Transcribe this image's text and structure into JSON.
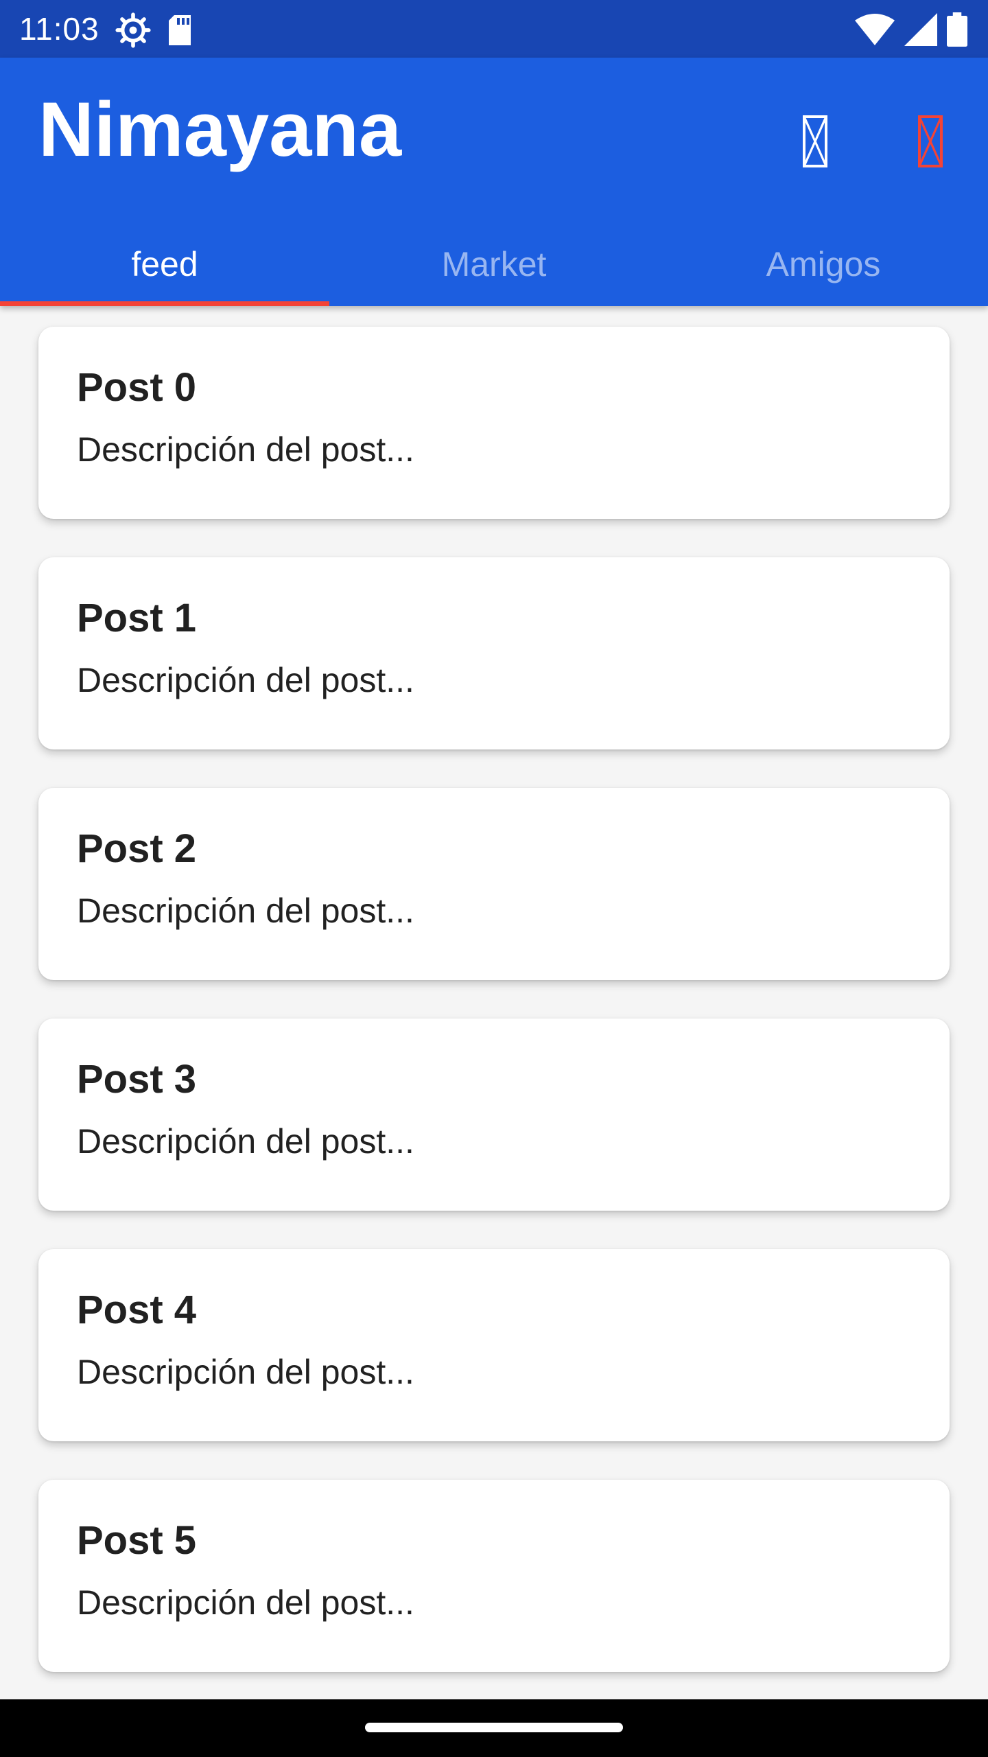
{
  "status_bar": {
    "time": "11:03",
    "icons": [
      "settings-icon",
      "sd-card-icon",
      "wifi-icon",
      "signal-icon",
      "battery-icon"
    ]
  },
  "app_bar": {
    "title": "Nimayana",
    "actions": [
      "placeholder-glyph-icon",
      "placeholder-glyph-icon"
    ],
    "colors": {
      "status_bar": "#1846b3",
      "app_bar": "#1c5ee0",
      "tab_indicator": "#f44336",
      "second_action": "#f44336"
    }
  },
  "tabs": [
    {
      "label": "feed"
    },
    {
      "label": "Market"
    },
    {
      "label": "Amigos"
    }
  ],
  "active_tab": "feed",
  "posts": [
    {
      "title": "Post 0",
      "description": "Descripción del post..."
    },
    {
      "title": "Post 1",
      "description": "Descripción del post..."
    },
    {
      "title": "Post 2",
      "description": "Descripción del post..."
    },
    {
      "title": "Post 3",
      "description": "Descripción del post..."
    },
    {
      "title": "Post 4",
      "description": "Descripción del post..."
    },
    {
      "title": "Post 5",
      "description": "Descripción del post..."
    }
  ]
}
